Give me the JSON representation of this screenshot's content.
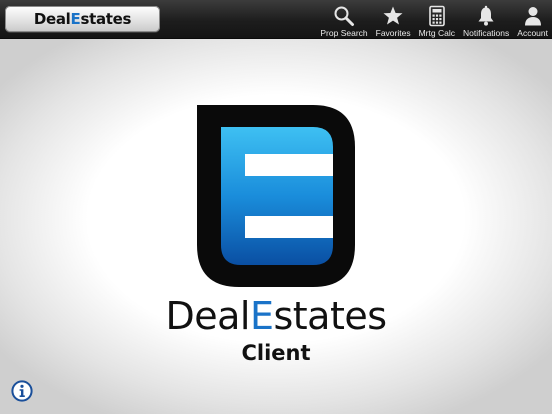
{
  "header": {
    "home_logo_prefix": "Deal",
    "home_logo_highlight": "E",
    "home_logo_suffix": "states",
    "nav": [
      {
        "label": "Prop Search",
        "icon": "search-icon"
      },
      {
        "label": "Favorites",
        "icon": "star-icon"
      },
      {
        "label": "Mrtg Calc",
        "icon": "calculator-icon"
      },
      {
        "label": "Notifications",
        "icon": "bell-icon"
      },
      {
        "label": "Account",
        "icon": "person-icon"
      }
    ]
  },
  "splash": {
    "brand_prefix": "Deal",
    "brand_highlight": "E",
    "brand_suffix": "states",
    "subtitle": "Client"
  },
  "colors": {
    "accent": "#1a73c8",
    "logo_blue_light": "#2aa8ea",
    "logo_blue_dark": "#0a4fa3",
    "topbar": "#1d1d1d"
  },
  "info_button": {
    "icon": "info-icon"
  }
}
